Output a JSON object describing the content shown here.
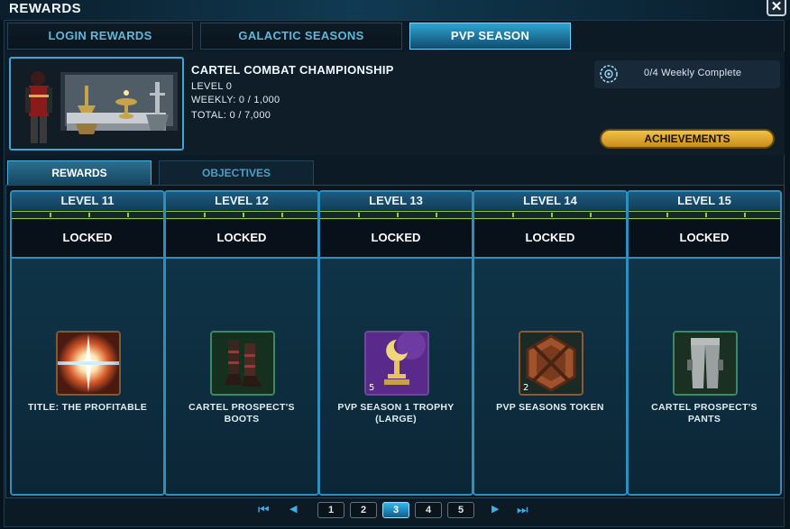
{
  "window": {
    "title": "REWARDS",
    "close_label": "✕"
  },
  "main_tabs": [
    {
      "label": "LOGIN REWARDS",
      "active": false
    },
    {
      "label": "GALACTIC SEASONS",
      "active": false
    },
    {
      "label": "PVP SEASON",
      "active": true
    }
  ],
  "season": {
    "title": "CARTEL COMBAT CHAMPIONSHIP",
    "level": "LEVEL 0",
    "weekly": "WEEKLY: 0 / 1,000",
    "total": "TOTAL: 0 / 7,000"
  },
  "weekly_status": {
    "text": "0/4 Weekly Complete",
    "icon": "weekly-objectives-icon"
  },
  "achievements_label": "ACHIEVEMENTS",
  "sub_tabs": [
    {
      "label": "REWARDS",
      "active": true
    },
    {
      "label": "OBJECTIVES",
      "active": false
    }
  ],
  "reward_cards": [
    {
      "level": "LEVEL 11",
      "status": "LOCKED",
      "item": "TITLE: THE PROFITABLE",
      "icon": "title-burst-icon",
      "stack": ""
    },
    {
      "level": "LEVEL 12",
      "status": "LOCKED",
      "item": "CARTEL PROSPECT'S BOOTS",
      "icon": "boots-icon",
      "stack": ""
    },
    {
      "level": "LEVEL 13",
      "status": "LOCKED",
      "item": "PVP SEASON 1 TROPHY (LARGE)",
      "icon": "trophy-icon",
      "stack": "5"
    },
    {
      "level": "LEVEL 14",
      "status": "LOCKED",
      "item": "PVP SEASONS TOKEN",
      "icon": "token-icon",
      "stack": "2"
    },
    {
      "level": "LEVEL 15",
      "status": "LOCKED",
      "item": "CARTEL PROSPECT'S PANTS",
      "icon": "pants-icon",
      "stack": ""
    }
  ],
  "pagination": {
    "pages": [
      "1",
      "2",
      "3",
      "4",
      "5"
    ],
    "current": "3",
    "first_glyph": "⏮",
    "prev_glyph": "◀",
    "next_glyph": "▶",
    "last_glyph": "⏭"
  },
  "colors": {
    "accent": "#2d8fbd",
    "active_tab": "#2fa4d2",
    "achievements_button": "#e0ad35",
    "progress_ticks": "#8fd23c"
  }
}
